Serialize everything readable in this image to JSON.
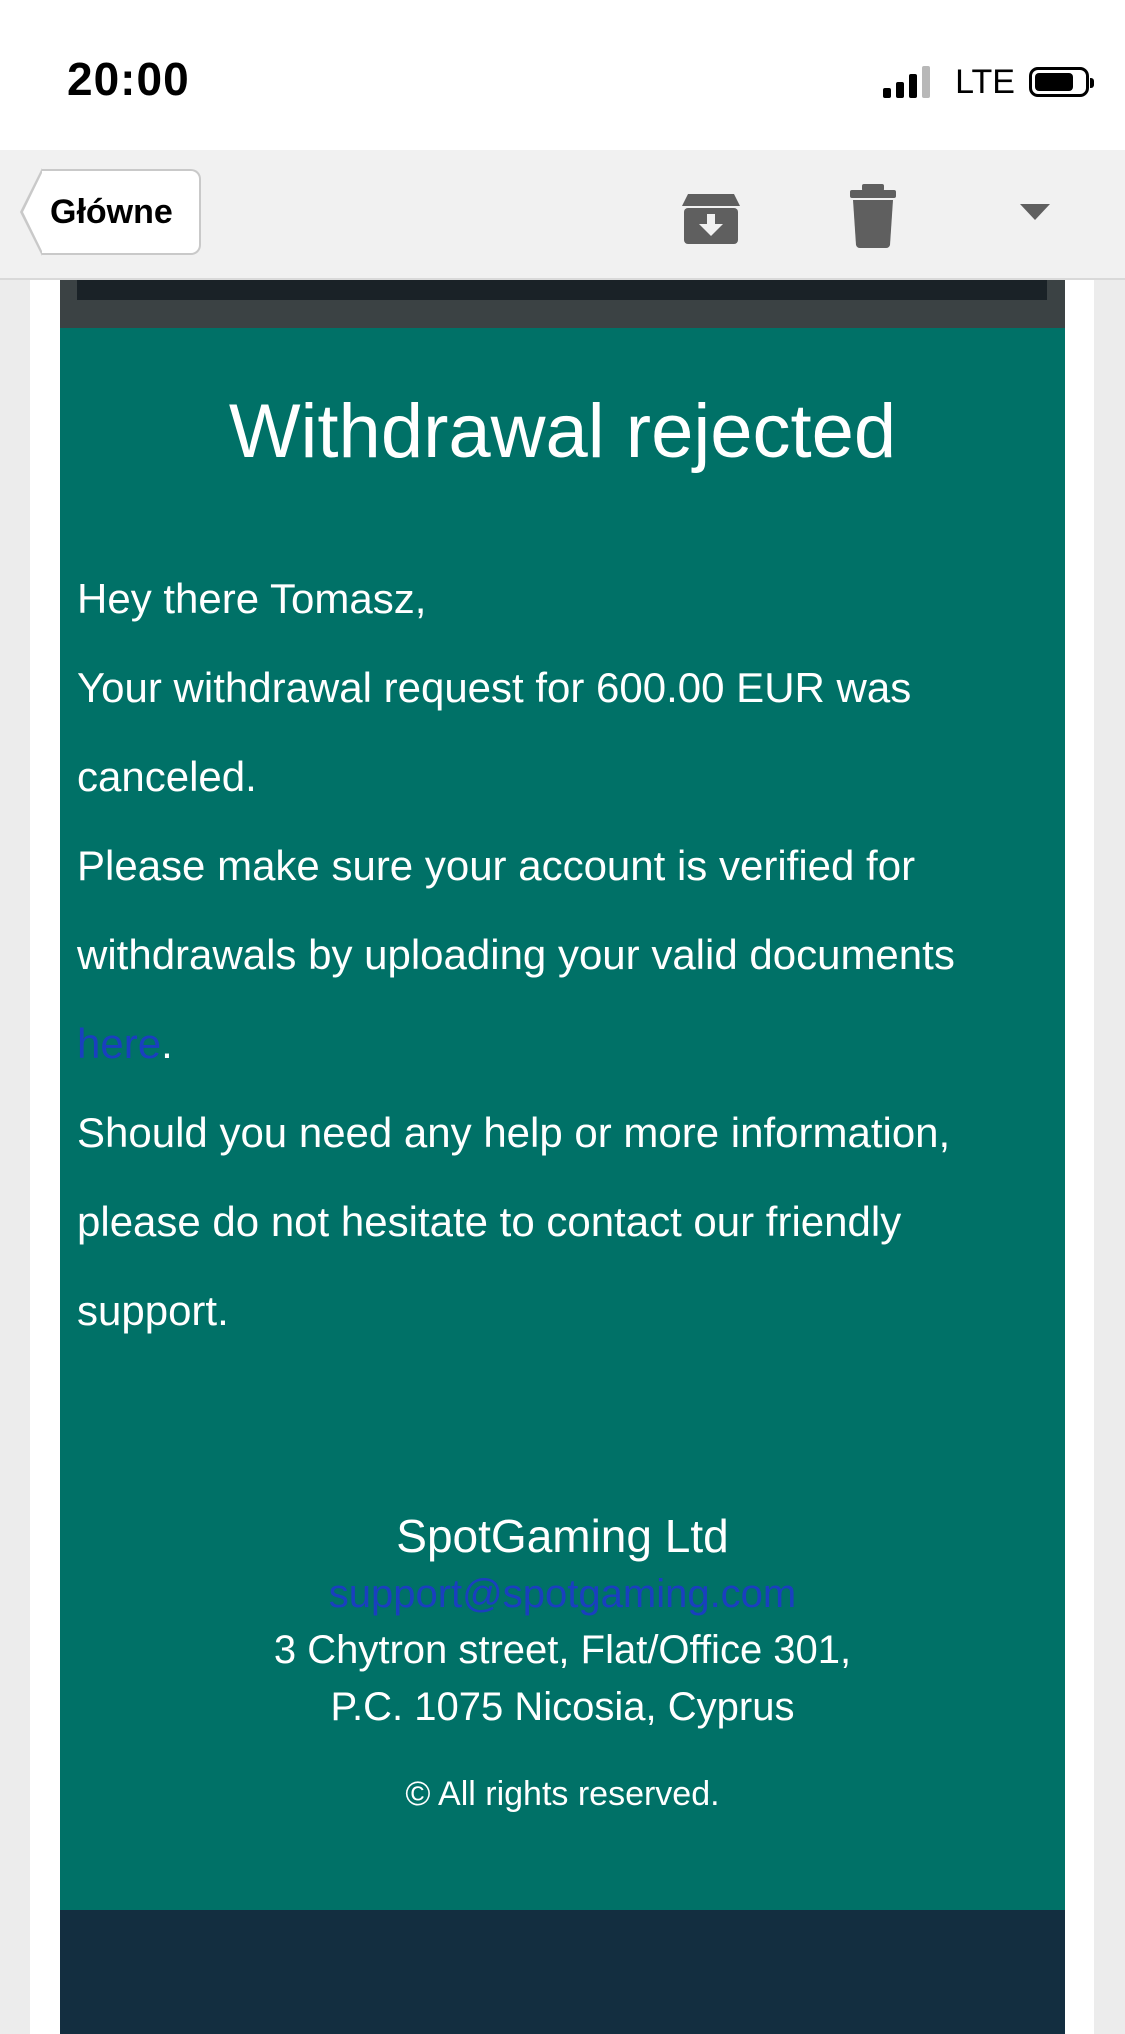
{
  "status_bar": {
    "time": "20:00",
    "network": "LTE",
    "signal_bars_active": 3,
    "signal_bars_total": 4,
    "battery_level": 0.8
  },
  "toolbar": {
    "back_label": "Główne",
    "icons": [
      "archive-icon",
      "trash-icon",
      "dropdown-arrow-icon"
    ]
  },
  "email": {
    "title": "Withdrawal rejected",
    "greeting": "Hey there Tomasz,",
    "paragraph_1": "Your withdrawal request for 600.00 EUR was canceled.",
    "paragraph_2_before_link": "Please make sure your account is verified for withdrawals by uploading your valid documents ",
    "paragraph_2_link": "here",
    "paragraph_2_after_link": ".",
    "paragraph_3": "Should you need any help or more information, please do not hesitate to contact our friendly support.",
    "footer": {
      "company": "SpotGaming Ltd",
      "email": "support@spotgaming.com",
      "address_line_1": "3 Chytron street, Flat/Office 301,",
      "address_line_2": "P.C. 1075 Nicosia, Cyprus",
      "rights": "©  All rights reserved."
    }
  },
  "colors": {
    "card_green": "#007167",
    "link_blue": "#1a3fbf",
    "footer_navy": "#132e40",
    "toolbar_bg": "#f1f1f1"
  }
}
